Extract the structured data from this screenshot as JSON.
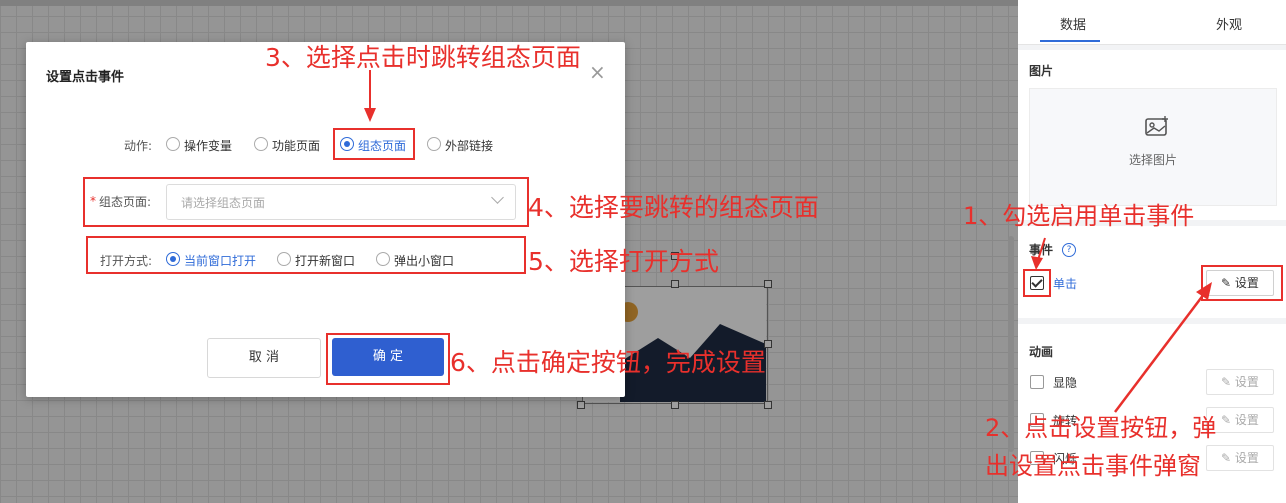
{
  "panel": {
    "tabs": [
      "数据",
      "外观"
    ],
    "image_section_title": "图片",
    "image_select_label": "选择图片",
    "event_section_title": "事件",
    "event_help": "?",
    "click_event_label": "单击",
    "click_event_checked": true,
    "set_label": "设置",
    "animation_section_title": "动画",
    "animation_items": [
      {
        "label": "显隐",
        "set_label": "设置"
      },
      {
        "label": "旋转",
        "set_label": "设置"
      },
      {
        "label": "闪烁",
        "set_label": "设置"
      }
    ]
  },
  "modal": {
    "title": "设置点击事件",
    "close": "×",
    "action_label": "动作:",
    "actions": [
      "操作变量",
      "功能页面",
      "组态页面",
      "外部链接"
    ],
    "action_selected": "组态页面",
    "page_label": "组态页面:",
    "page_required_mark": "*",
    "page_placeholder": "请选择组态页面",
    "open_label": "打开方式:",
    "open_options": [
      "当前窗口打开",
      "打开新窗口",
      "弹出小窗口"
    ],
    "open_selected": "当前窗口打开",
    "cancel_label": "取 消",
    "ok_label": "确 定"
  },
  "annotations": {
    "step1": "1、勾选启用单击事件",
    "step2_line1": "2、点击设置按钮，弹",
    "step2_line2": "出设置点击事件弹窗",
    "step3": "3、选择点击时跳转组态页面",
    "step4": "4、选择要跳转的组态页面",
    "step5": "5、选择打开方式",
    "step6": "6、点击确定按钮，完成设置"
  },
  "colors": {
    "accent": "#2f6bd8",
    "annotation": "#e8302c",
    "primary_button": "#2f5fd0"
  }
}
